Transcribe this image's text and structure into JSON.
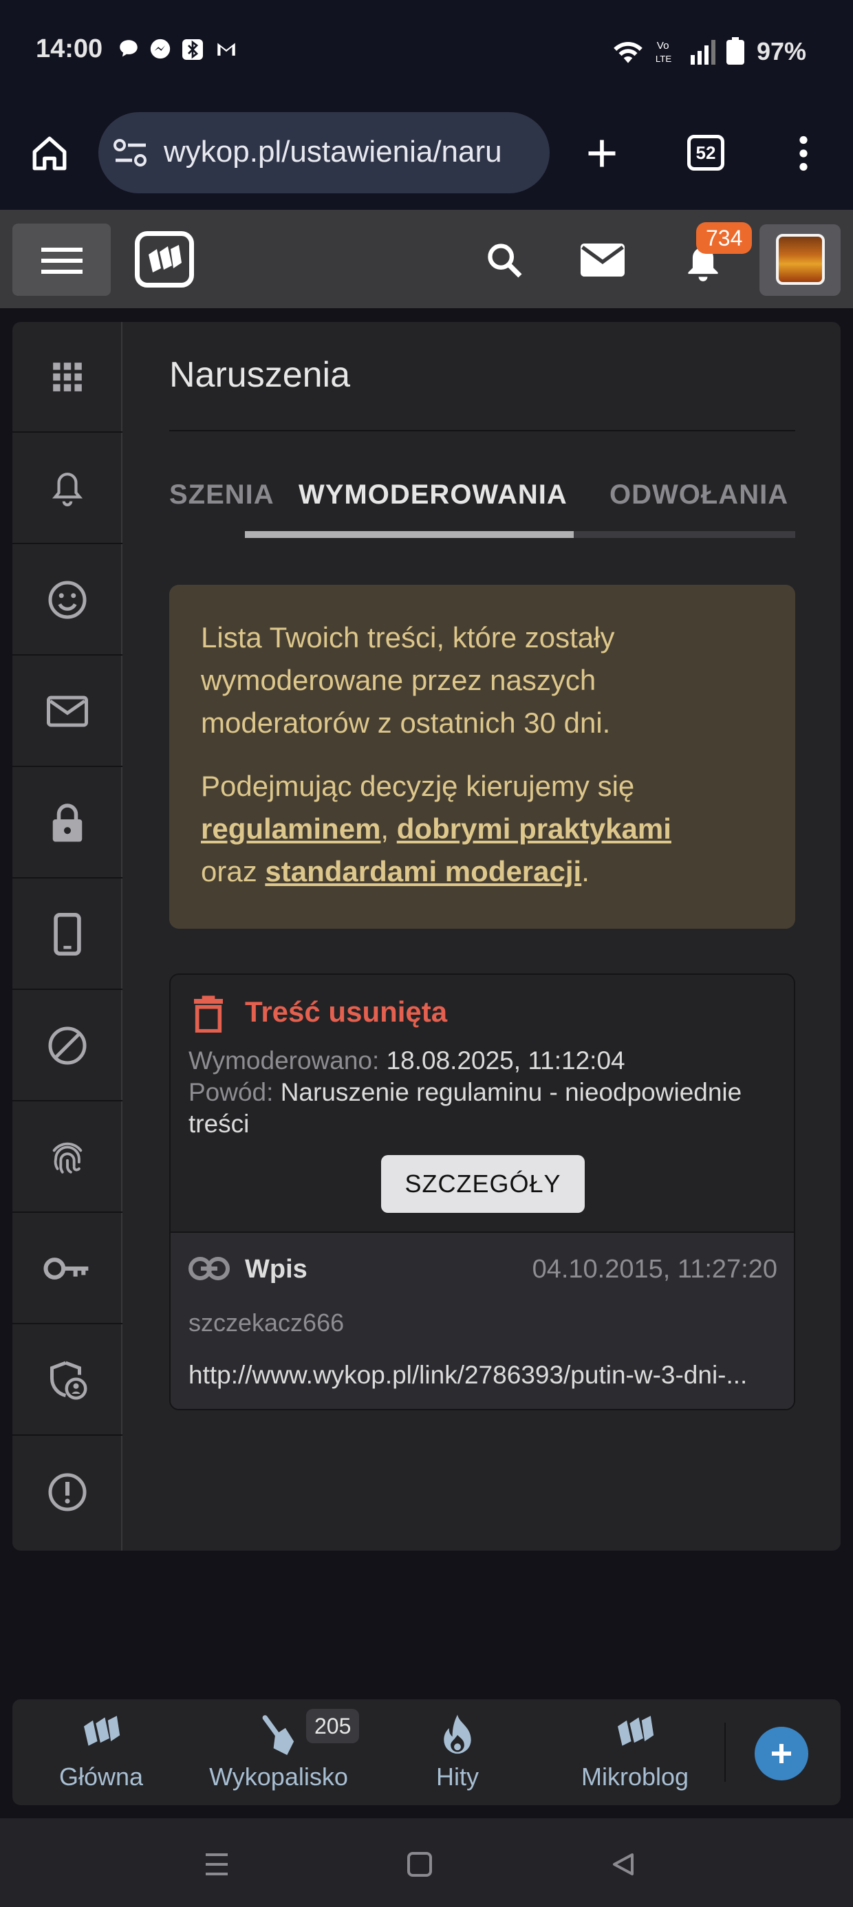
{
  "status_bar": {
    "time": "14:00",
    "battery": "97%"
  },
  "browser": {
    "url": "wykop.pl/ustawienia/naru",
    "tab_count": "52"
  },
  "header": {
    "notification_count": "734"
  },
  "page": {
    "title": "Naruszenia",
    "tabs": [
      {
        "label": "ZGŁOSZENIA",
        "visible_label": "SZENIA",
        "active": false
      },
      {
        "label": "WYMODEROWANIA",
        "active": true
      },
      {
        "label": "ODWOŁANIA",
        "active": false
      }
    ],
    "info": {
      "para1": "Lista Twoich treści, które zostały wymoderowane przez naszych moderatorów z ostatnich 30 dni.",
      "para2_prefix": "Podejmując decyzję kierujemy się",
      "link1": "regulaminem",
      "comma": ",",
      "link2": "dobrymi praktykami",
      "oraz": "oraz",
      "link3": "standardami moderacji",
      "period": "."
    },
    "moderation": {
      "title": "Treść usunięta",
      "moderated_label": "Wymoderowano:",
      "moderated_value": "18.08.2025, 11:12:04",
      "reason_label": "Powód:",
      "reason_value": "Naruszenie regulaminu - nieodpowiednie treści",
      "details_button": "SZCZEGÓŁY",
      "entry": {
        "type": "Wpis",
        "date": "04.10.2015, 11:27:20",
        "user": "szczekacz666",
        "url": "http://www.wykop.pl/link/2786393/putin-w-3-dni-..."
      }
    }
  },
  "bottom_nav": {
    "items": [
      {
        "label": "Główna",
        "icon": "home-logo-icon"
      },
      {
        "label": "Wykopalisko",
        "icon": "shovel-icon",
        "badge": "205"
      },
      {
        "label": "Hity",
        "icon": "flame-icon"
      },
      {
        "label": "Mikroblog",
        "icon": "microblog-icon"
      }
    ],
    "add_icon": "plus-icon"
  },
  "colors": {
    "accent_red": "#e4604f",
    "info_bg": "#473f32",
    "info_text": "#ddc78c",
    "badge_orange": "#ec6a2c",
    "add_blue": "#3a86c5"
  }
}
